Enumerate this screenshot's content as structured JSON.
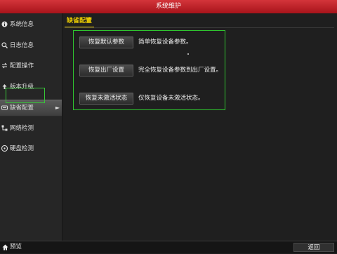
{
  "window": {
    "title": "系统维护"
  },
  "sidebar": {
    "items": [
      {
        "label": "系统信息",
        "icon": "info-icon"
      },
      {
        "label": "日志信息",
        "icon": "search-icon"
      },
      {
        "label": "配置操作",
        "icon": "swap-icon"
      },
      {
        "label": "版本升级",
        "icon": "upload-icon"
      },
      {
        "label": "缺省配置",
        "icon": "restore-icon",
        "active": true
      },
      {
        "label": "网络检测",
        "icon": "network-icon"
      },
      {
        "label": "硬盘检测",
        "icon": "disk-icon"
      }
    ]
  },
  "tab": {
    "label": "缺省配置"
  },
  "actions": [
    {
      "button": "恢复默认参数",
      "description": "简单恢复设备参数。"
    },
    {
      "button": "恢复出厂设置",
      "description": "完全恢复设备参数到出厂设置。"
    },
    {
      "button": "恢复未激活状态",
      "description": "仅恢复设备未激活状态。"
    }
  ],
  "bottom": {
    "preview_label": "预览",
    "back_label": "返回"
  },
  "colors": {
    "title_bar": "#c0222a",
    "accent_tab": "#f0d000",
    "highlight": "#2fc52f"
  }
}
